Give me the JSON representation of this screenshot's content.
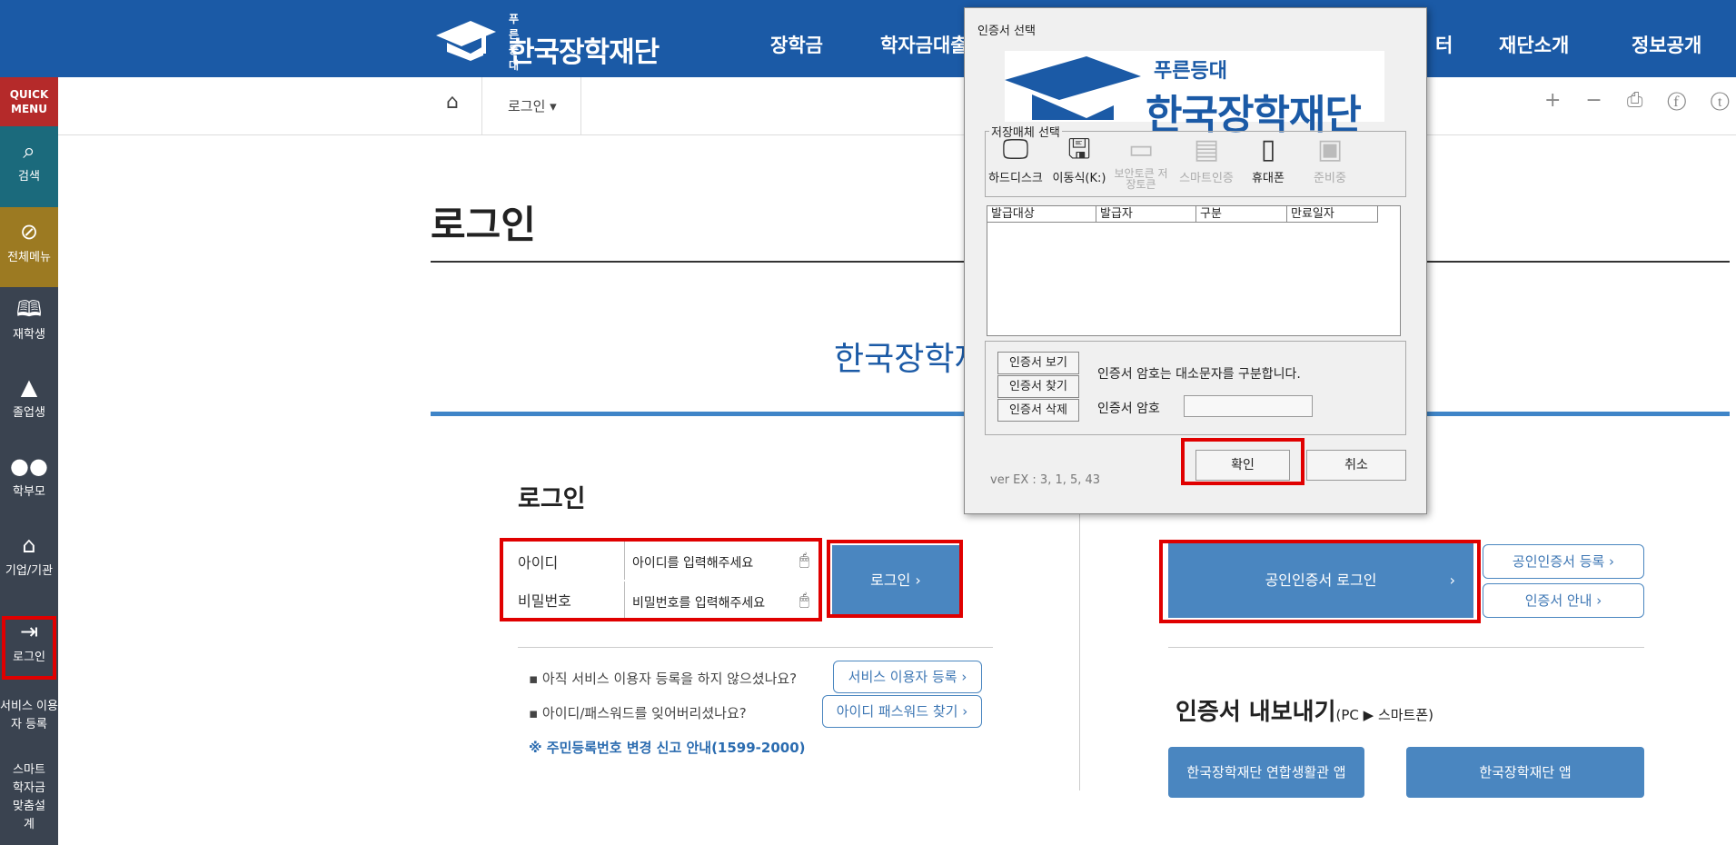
{
  "header": {
    "logo_small": "푸른등대",
    "logo_big": "한국장학재단",
    "nav": [
      "장학금",
      "학자금대출",
      "터",
      "재단소개",
      "정보공개"
    ]
  },
  "quick_menu": {
    "title": "QUICK MENU",
    "items": [
      "검색",
      "전체메뉴",
      "재학생",
      "졸업생",
      "학부모",
      "기업/기관",
      "로그인",
      "서비스 이용자 등록",
      "스마트 학자금 맞춤설계"
    ]
  },
  "breadcrumb": {
    "current": "로그인 ▾"
  },
  "tools": "+ − ⎙ ⓕ ⓣ ⓑ",
  "page": {
    "title": "로그인",
    "subtitle": "한국장학재",
    "login_heading": "로그인",
    "id_label": "아이디",
    "pw_label": "비밀번호",
    "id_placeholder": "아이디를 입력해주세요",
    "pw_placeholder": "비밀번호를 입력해주세요",
    "login_button": "로그인   ›",
    "note1": "▪ 아직 서비스 이용자 등록을 하지 않으셨나요?",
    "note2": "▪ 아이디/패스워드를 잊어버리셨나요?",
    "register_button": "서비스 이용자 등록 ›",
    "find_button": "아이디 패스워드 찾기 ›",
    "resident_notice": "※ 주민등록번호 변경 신고 안내(1599-2000)",
    "cert_login_button": "공인인증서 로그인",
    "cert_register_button": "공인인증서 등록   ›",
    "cert_guide_button": "인증서 안내     ›",
    "export_heading": "인증서 내보내기",
    "export_sub": "(PC ▶ 스마트폰)",
    "app1_button": "한국장학재단 연합생활관 앱",
    "app2_button": "한국장학재단 앱"
  },
  "dialog": {
    "title": "인증서 선택",
    "logo_small": "푸른등대",
    "logo_big": "한국장학재단",
    "media_legend": "저장매체 선택",
    "media": [
      {
        "label": "하드디스크",
        "icon": "monitor-icon",
        "enabled": true
      },
      {
        "label": "이동식(K:)",
        "icon": "usb-drive-icon",
        "enabled": true
      },
      {
        "label": "보안토큰 저장토큰",
        "icon": "security-token-icon",
        "enabled": false
      },
      {
        "label": "스마트인증",
        "icon": "smart-auth-icon",
        "enabled": false
      },
      {
        "label": "휴대폰",
        "icon": "phone-icon",
        "enabled": true
      },
      {
        "label": "준비중",
        "icon": "pending-icon",
        "enabled": false
      }
    ],
    "columns": [
      "발급대상",
      "발급자",
      "구분",
      "만료일자"
    ],
    "view_button": "인증서 보기",
    "find_button": "인증서 찾기",
    "delete_button": "인증서 삭제",
    "case_note": "인증서 암호는 대소문자를 구분합니다.",
    "pw_label": "인증서 암호",
    "ok_button": "확인",
    "cancel_button": "취소",
    "version": "ver EX : 3, 1, 5, 43"
  }
}
